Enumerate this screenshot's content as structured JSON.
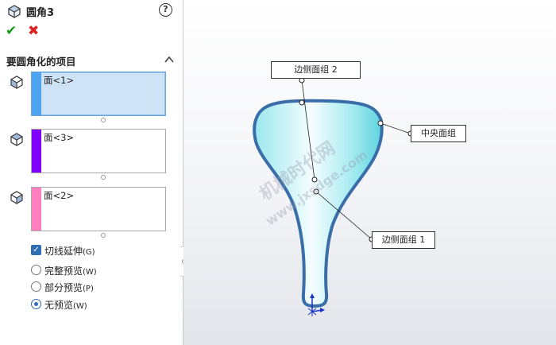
{
  "panel": {
    "title": "圆角3",
    "help_icon": "help-icon",
    "confirm_icon": "check-icon",
    "cancel_icon": "x-icon",
    "section": {
      "label": "要圆角化的项目"
    },
    "selections": [
      {
        "item": "面<1>",
        "color": "#4da3f0",
        "active": true
      },
      {
        "item": "面<3>",
        "color": "#7f00ff",
        "active": false
      },
      {
        "item": "面<2>",
        "color": "#ff7fbf",
        "active": false
      }
    ],
    "tangent": {
      "label": "切线延伸",
      "hotkey": "(G)",
      "checked": true
    },
    "preview_options": [
      {
        "label": "完整预览",
        "hotkey": "(W)",
        "selected": false
      },
      {
        "label": "部分预览",
        "hotkey": "(P)",
        "selected": false
      },
      {
        "label": "无预览",
        "hotkey": "(W)",
        "selected": true
      }
    ]
  },
  "viewport": {
    "callouts": {
      "side_face_2": "边侧面组 2",
      "center_face": "中央面组",
      "side_face_1": "边侧面组 1"
    },
    "watermark": {
      "line1": "机械时代网",
      "line2": "www.jxsdge.com"
    },
    "colors": {
      "outline": "#3a6ea8",
      "fill_light": "#e8fbfd",
      "fill_dark": "#72dbe6"
    }
  }
}
